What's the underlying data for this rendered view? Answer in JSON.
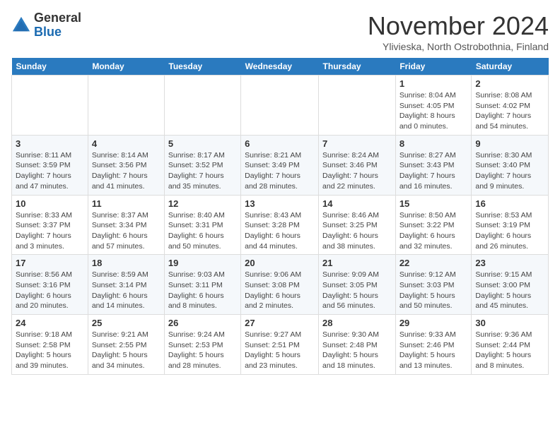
{
  "logo": {
    "general": "General",
    "blue": "Blue"
  },
  "header": {
    "month": "November 2024",
    "location": "Ylivieska, North Ostrobothnia, Finland"
  },
  "weekdays": [
    "Sunday",
    "Monday",
    "Tuesday",
    "Wednesday",
    "Thursday",
    "Friday",
    "Saturday"
  ],
  "weeks": [
    [
      {
        "day": "",
        "info": ""
      },
      {
        "day": "",
        "info": ""
      },
      {
        "day": "",
        "info": ""
      },
      {
        "day": "",
        "info": ""
      },
      {
        "day": "",
        "info": ""
      },
      {
        "day": "1",
        "info": "Sunrise: 8:04 AM\nSunset: 4:05 PM\nDaylight: 8 hours and 0 minutes."
      },
      {
        "day": "2",
        "info": "Sunrise: 8:08 AM\nSunset: 4:02 PM\nDaylight: 7 hours and 54 minutes."
      }
    ],
    [
      {
        "day": "3",
        "info": "Sunrise: 8:11 AM\nSunset: 3:59 PM\nDaylight: 7 hours and 47 minutes."
      },
      {
        "day": "4",
        "info": "Sunrise: 8:14 AM\nSunset: 3:56 PM\nDaylight: 7 hours and 41 minutes."
      },
      {
        "day": "5",
        "info": "Sunrise: 8:17 AM\nSunset: 3:52 PM\nDaylight: 7 hours and 35 minutes."
      },
      {
        "day": "6",
        "info": "Sunrise: 8:21 AM\nSunset: 3:49 PM\nDaylight: 7 hours and 28 minutes."
      },
      {
        "day": "7",
        "info": "Sunrise: 8:24 AM\nSunset: 3:46 PM\nDaylight: 7 hours and 22 minutes."
      },
      {
        "day": "8",
        "info": "Sunrise: 8:27 AM\nSunset: 3:43 PM\nDaylight: 7 hours and 16 minutes."
      },
      {
        "day": "9",
        "info": "Sunrise: 8:30 AM\nSunset: 3:40 PM\nDaylight: 7 hours and 9 minutes."
      }
    ],
    [
      {
        "day": "10",
        "info": "Sunrise: 8:33 AM\nSunset: 3:37 PM\nDaylight: 7 hours and 3 minutes."
      },
      {
        "day": "11",
        "info": "Sunrise: 8:37 AM\nSunset: 3:34 PM\nDaylight: 6 hours and 57 minutes."
      },
      {
        "day": "12",
        "info": "Sunrise: 8:40 AM\nSunset: 3:31 PM\nDaylight: 6 hours and 50 minutes."
      },
      {
        "day": "13",
        "info": "Sunrise: 8:43 AM\nSunset: 3:28 PM\nDaylight: 6 hours and 44 minutes."
      },
      {
        "day": "14",
        "info": "Sunrise: 8:46 AM\nSunset: 3:25 PM\nDaylight: 6 hours and 38 minutes."
      },
      {
        "day": "15",
        "info": "Sunrise: 8:50 AM\nSunset: 3:22 PM\nDaylight: 6 hours and 32 minutes."
      },
      {
        "day": "16",
        "info": "Sunrise: 8:53 AM\nSunset: 3:19 PM\nDaylight: 6 hours and 26 minutes."
      }
    ],
    [
      {
        "day": "17",
        "info": "Sunrise: 8:56 AM\nSunset: 3:16 PM\nDaylight: 6 hours and 20 minutes."
      },
      {
        "day": "18",
        "info": "Sunrise: 8:59 AM\nSunset: 3:14 PM\nDaylight: 6 hours and 14 minutes."
      },
      {
        "day": "19",
        "info": "Sunrise: 9:03 AM\nSunset: 3:11 PM\nDaylight: 6 hours and 8 minutes."
      },
      {
        "day": "20",
        "info": "Sunrise: 9:06 AM\nSunset: 3:08 PM\nDaylight: 6 hours and 2 minutes."
      },
      {
        "day": "21",
        "info": "Sunrise: 9:09 AM\nSunset: 3:05 PM\nDaylight: 5 hours and 56 minutes."
      },
      {
        "day": "22",
        "info": "Sunrise: 9:12 AM\nSunset: 3:03 PM\nDaylight: 5 hours and 50 minutes."
      },
      {
        "day": "23",
        "info": "Sunrise: 9:15 AM\nSunset: 3:00 PM\nDaylight: 5 hours and 45 minutes."
      }
    ],
    [
      {
        "day": "24",
        "info": "Sunrise: 9:18 AM\nSunset: 2:58 PM\nDaylight: 5 hours and 39 minutes."
      },
      {
        "day": "25",
        "info": "Sunrise: 9:21 AM\nSunset: 2:55 PM\nDaylight: 5 hours and 34 minutes."
      },
      {
        "day": "26",
        "info": "Sunrise: 9:24 AM\nSunset: 2:53 PM\nDaylight: 5 hours and 28 minutes."
      },
      {
        "day": "27",
        "info": "Sunrise: 9:27 AM\nSunset: 2:51 PM\nDaylight: 5 hours and 23 minutes."
      },
      {
        "day": "28",
        "info": "Sunrise: 9:30 AM\nSunset: 2:48 PM\nDaylight: 5 hours and 18 minutes."
      },
      {
        "day": "29",
        "info": "Sunrise: 9:33 AM\nSunset: 2:46 PM\nDaylight: 5 hours and 13 minutes."
      },
      {
        "day": "30",
        "info": "Sunrise: 9:36 AM\nSunset: 2:44 PM\nDaylight: 5 hours and 8 minutes."
      }
    ]
  ]
}
